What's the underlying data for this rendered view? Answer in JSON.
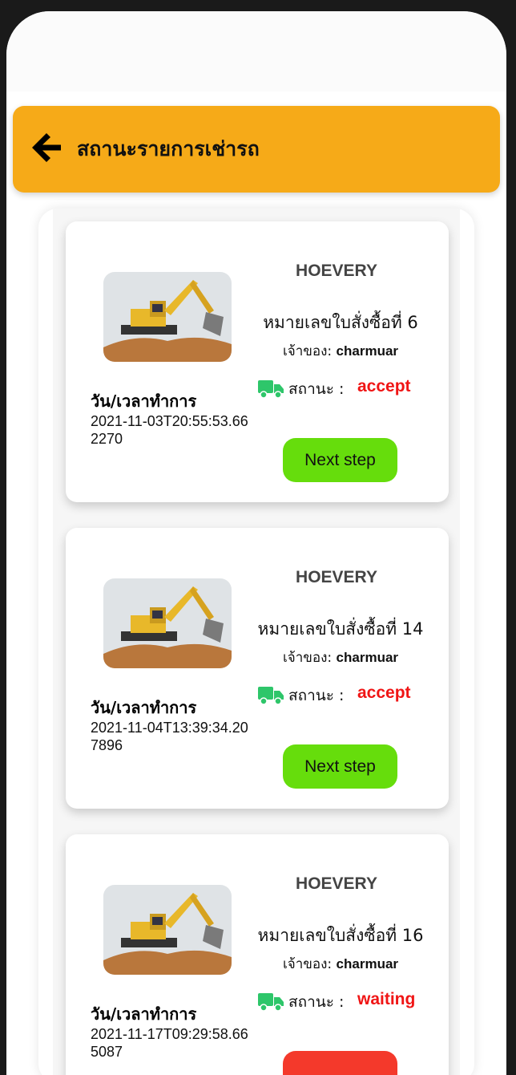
{
  "header": {
    "title": "สถานะรายการเช่ารถ"
  },
  "labels": {
    "date_label": "วัน/เวลาทำการ",
    "owner_prefix": "เจ้าของ:",
    "status_prefix": "สถานะ :"
  },
  "orders": [
    {
      "shop": "HOEVERY",
      "order_title": "หมายเลขใบสั่งซื้อที่ 6",
      "owner": "charmuar",
      "status": "accept",
      "datetime": "2021-11-03T20:55:53.662270",
      "button": "Next step"
    },
    {
      "shop": "HOEVERY",
      "order_title": "หมายเลขใบสั่งซื้อที่ 14",
      "owner": "charmuar",
      "status": "accept",
      "datetime": "2021-11-04T13:39:34.207896",
      "button": "Next step"
    },
    {
      "shop": "HOEVERY",
      "order_title": "หมายเลขใบสั่งซื้อที่ 16",
      "owner": "charmuar",
      "status": "waiting",
      "datetime": "2021-11-17T09:29:58.665087",
      "button": ""
    }
  ],
  "colors": {
    "header": "#f6aa18",
    "next_button": "#66dd0c",
    "waiting_button": "#f4392b",
    "status_text": "#f01515",
    "truck_icon": "#2ec66a"
  },
  "icons": {
    "back": "arrow-left-icon",
    "truck": "truck-icon"
  }
}
